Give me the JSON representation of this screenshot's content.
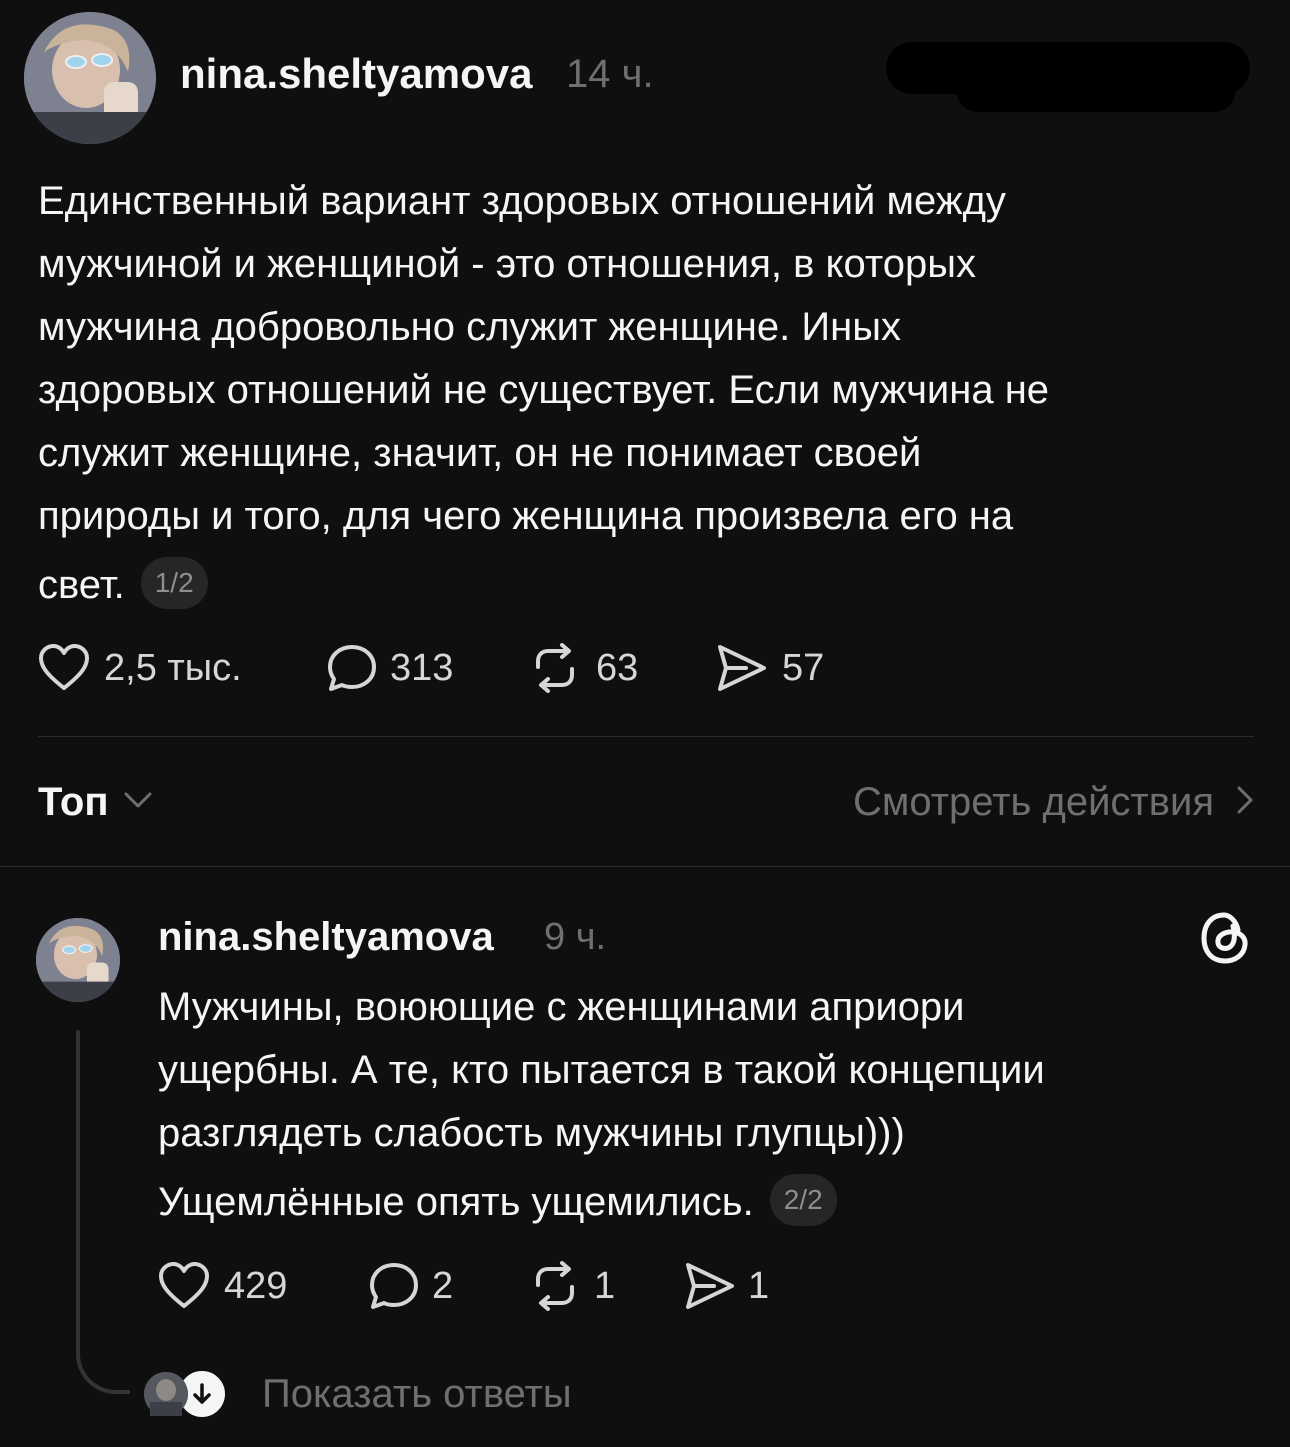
{
  "post": {
    "username": "nina.sheltyamova",
    "time": "14 ч.",
    "lines": [
      "Единственный вариант здоровых отношений между",
      "мужчиной и женщиной - это отношения, в которых",
      "мужчина добровольно служит женщине. Иных",
      "здоровых отношений не существует. Если мужчина не",
      "служит женщине, значит, он не понимает своей",
      "природы и того, для чего женщина произвела его на"
    ],
    "last_line": "свет.",
    "counter": "1/2",
    "likes": "2,5 тыс.",
    "comments": "313",
    "reposts": "63",
    "shares": "57"
  },
  "sort": {
    "label": "Топ",
    "activity_link": "Смотреть действия"
  },
  "reply": {
    "username": "nina.sheltyamova",
    "time": "9 ч.",
    "lines": [
      "Мужчины, воюющие с женщинами априори",
      "ущербны. А те, кто пытается в такой концепции",
      "разглядеть слабость мужчины глупцы)))"
    ],
    "last_line": "Ущемлённые опять ущемились.",
    "counter": "2/2",
    "likes": "429",
    "comments": "2",
    "reposts": "1",
    "shares": "1",
    "show_replies": "Показать ответы"
  },
  "icons": {
    "heart": "heart-icon",
    "comment": "comment-icon",
    "repost": "repost-icon",
    "share": "share-icon",
    "threads_logo": "threads-logo-icon",
    "chevron_down": "chevron-down-icon",
    "chevron_right": "chevron-right-icon",
    "arrow_down": "arrow-down-icon"
  },
  "colors": {
    "background": "#0f0f0f",
    "text": "#f3f5f7",
    "muted": "#6f6f6f",
    "divider": "#2b2b2b"
  }
}
